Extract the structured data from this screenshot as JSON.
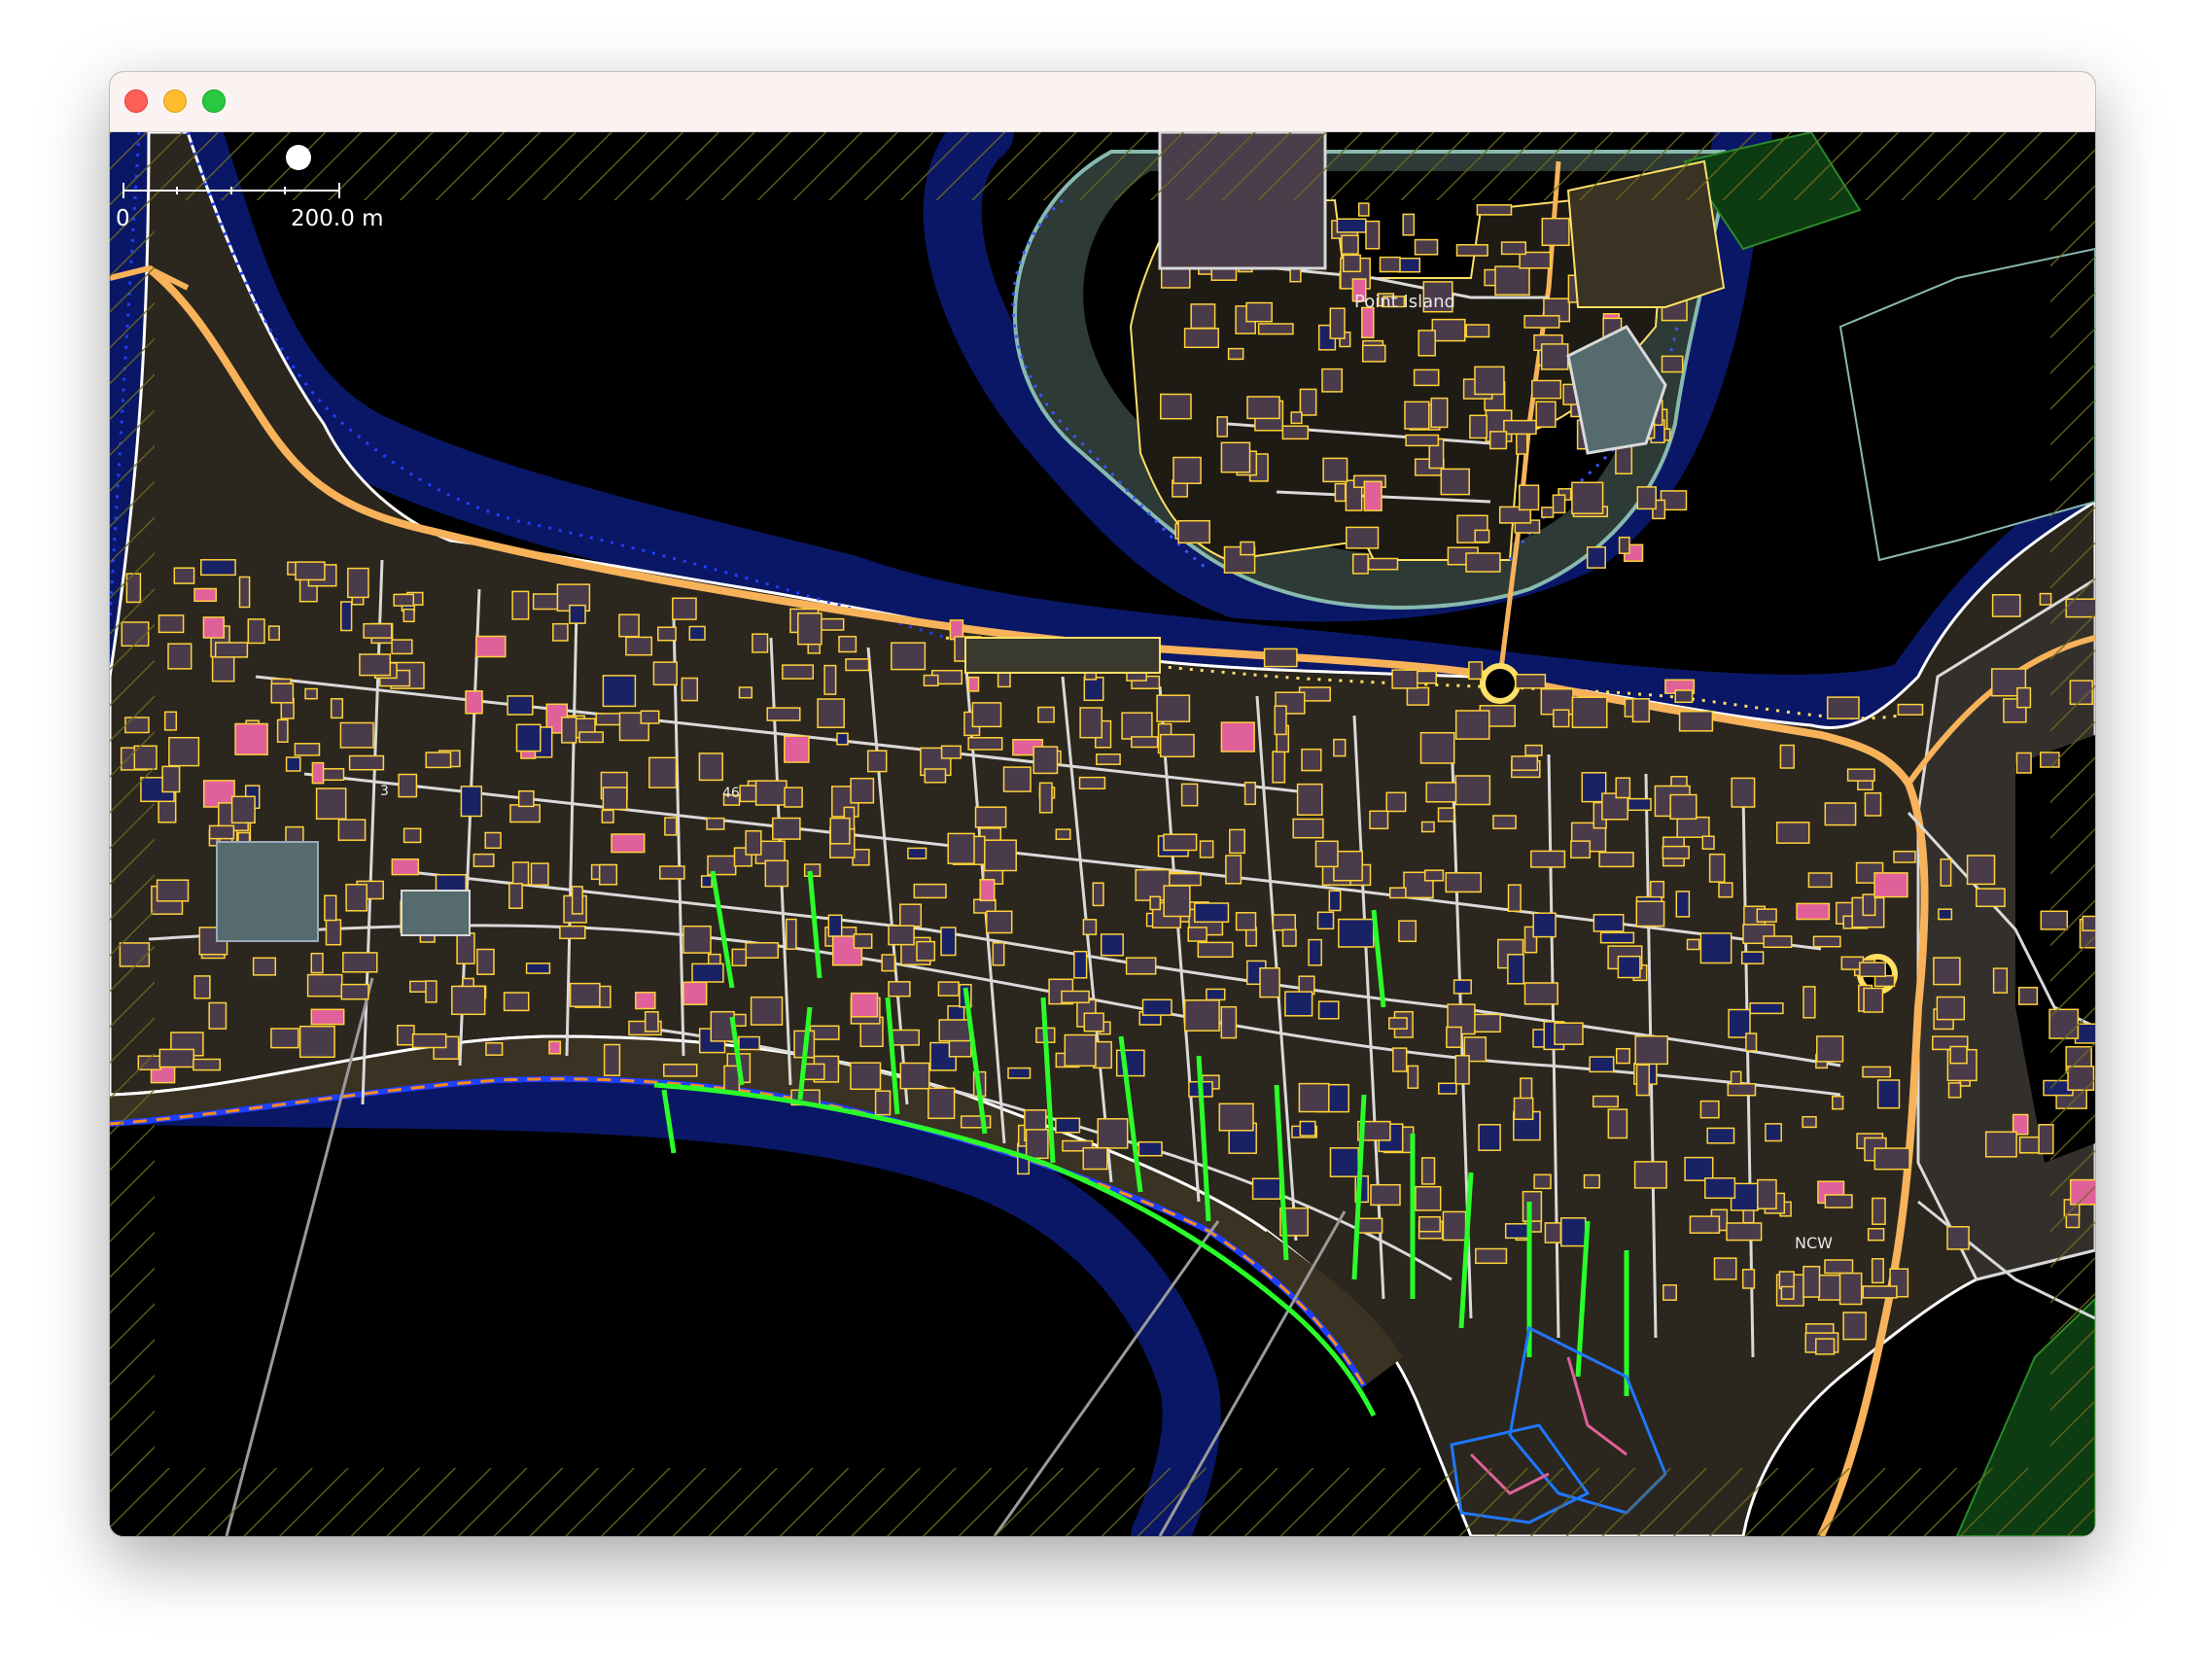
{
  "window": {
    "title": ""
  },
  "map": {
    "scale_bar": {
      "start_label": "0",
      "end_label": "200.0 m"
    },
    "labels": {
      "island": "Point Island",
      "house_number_46": "46",
      "house_number_3": "3",
      "ncw": "NCW"
    },
    "colors": {
      "background": "#000000",
      "water_halo": "#0a1a66",
      "coastline": "#1f3fff",
      "building_outline": "#ffd23a",
      "building_fill": "#4a3b4a",
      "road_primary": "#f7b25a",
      "road_residential": "#d9d9d9",
      "path_highlight": "#2aff2a",
      "selected_building": "#e0609a",
      "dark_building": "#1a2266",
      "land": "#2b261e",
      "parking": "#556b6e",
      "forest": "#0d3b12"
    }
  }
}
